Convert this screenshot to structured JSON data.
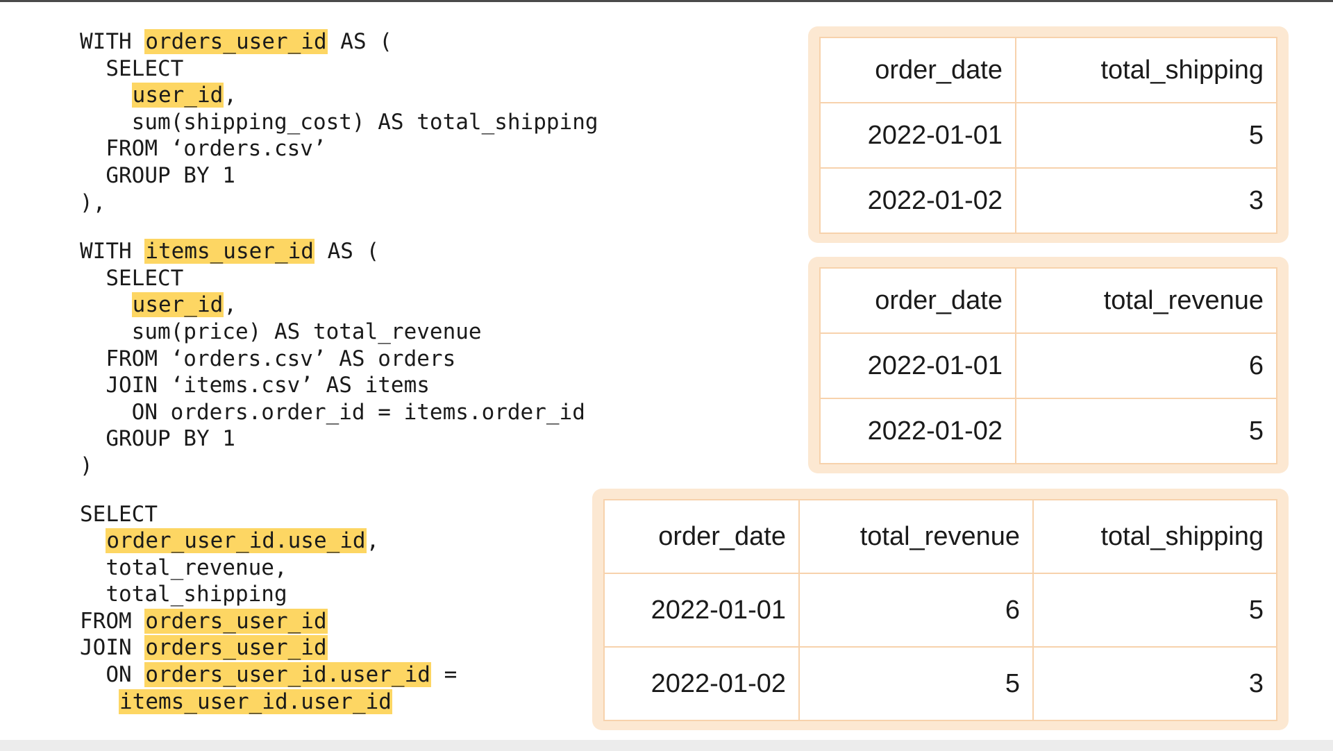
{
  "code": {
    "block1": {
      "l1_a": "WITH ",
      "l1_hl": "orders_user_id",
      "l1_b": " AS (",
      "l2": "  SELECT",
      "l3_a": "    ",
      "l3_hl": "user_id",
      "l3_b": ",",
      "l4": "    sum(shipping_cost) AS total_shipping",
      "l5": "  FROM ‘orders.csv’",
      "l6": "  GROUP BY 1",
      "l7": "),"
    },
    "block2": {
      "l1_a": "WITH ",
      "l1_hl": "items_user_id",
      "l1_b": " AS (",
      "l2": "  SELECT",
      "l3_a": "    ",
      "l3_hl": "user_id",
      "l3_b": ",",
      "l4": "    sum(price) AS total_revenue",
      "l5": "  FROM ‘orders.csv’ AS orders",
      "l6": "  JOIN ‘items.csv’ AS items",
      "l7": "    ON orders.order_id = items.order_id",
      "l8": "  GROUP BY 1",
      "l9": ")"
    },
    "block3": {
      "l1": "SELECT",
      "l2_a": "  ",
      "l2_hl": "order_user_id.use_id",
      "l2_b": ",",
      "l3": "  total_revenue,",
      "l4": "  total_shipping",
      "l5_a": "FROM ",
      "l5_hl": "orders_user_id",
      "l6_a": "JOIN ",
      "l6_hl": "orders_user_id",
      "l7_a": "  ON ",
      "l7_hl": "orders_user_id.user_id",
      "l7_b": " =",
      "l8_a": "   ",
      "l8_hl": "items_user_id.user_id"
    }
  },
  "tables": {
    "shipping": {
      "headers": [
        "order_date",
        "total_shipping"
      ],
      "rows": [
        [
          "2022-01-01",
          "5"
        ],
        [
          "2022-01-02",
          "3"
        ]
      ]
    },
    "revenue": {
      "headers": [
        "order_date",
        "total_revenue"
      ],
      "rows": [
        [
          "2022-01-01",
          "6"
        ],
        [
          "2022-01-02",
          "5"
        ]
      ]
    },
    "joined": {
      "headers": [
        "order_date",
        "total_revenue",
        "total_shipping"
      ],
      "rows": [
        [
          "2022-01-01",
          "6",
          "5"
        ],
        [
          "2022-01-02",
          "5",
          "3"
        ]
      ]
    }
  },
  "colors": {
    "highlight": "#fdd663",
    "frame": "#fce8d2",
    "grid": "#f7d2ac"
  }
}
